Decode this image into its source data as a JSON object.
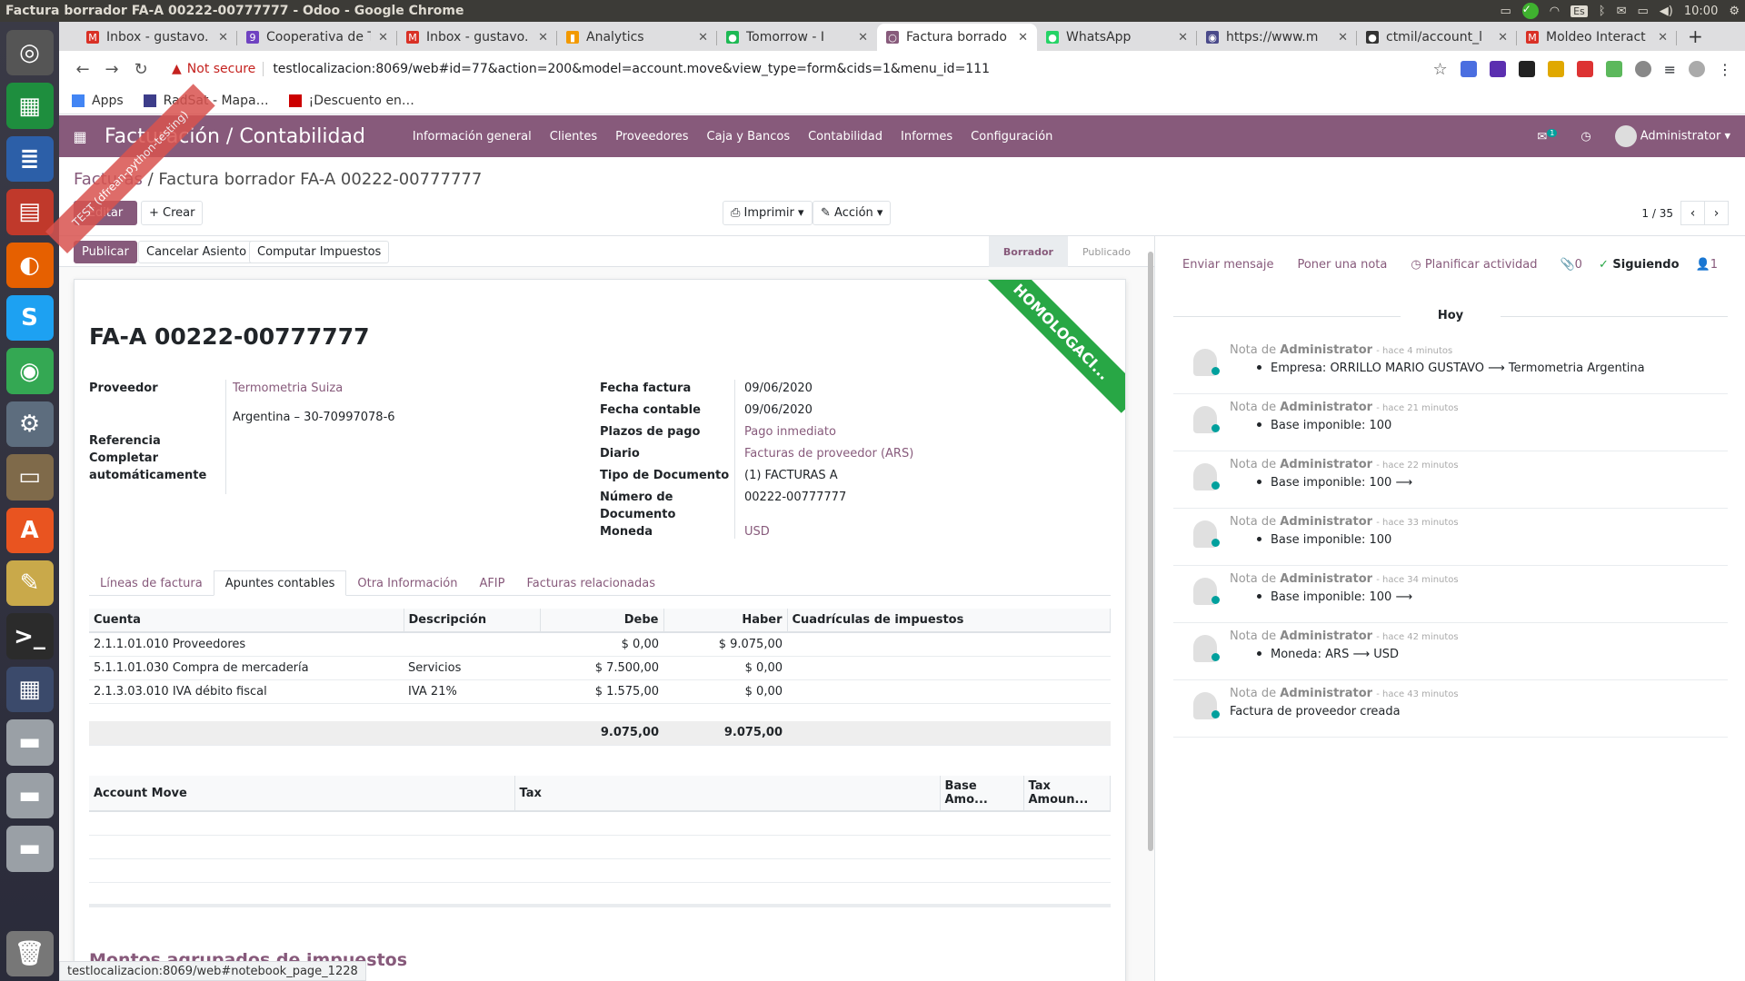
{
  "window_title": "Factura borrador FA-A 00222-00777777 - Odoo - Google Chrome",
  "system": {
    "lang": "Es",
    "time": "10:00"
  },
  "tabs": [
    {
      "label": "Inbox - gustavo.",
      "color": "#d93025",
      "fav": "M"
    },
    {
      "label": "Cooperativa de T",
      "color": "#6f42c1",
      "fav": "9"
    },
    {
      "label": "Inbox - gustavo.",
      "color": "#d93025",
      "fav": "M"
    },
    {
      "label": "Analytics",
      "color": "#f29900",
      "fav": "▮"
    },
    {
      "label": "Tomorrow - I",
      "color": "#1db954",
      "fav": "●"
    },
    {
      "label": "Factura borrado",
      "color": "#875a7b",
      "fav": "○"
    },
    {
      "label": "WhatsApp",
      "color": "#25d366",
      "fav": "●"
    },
    {
      "label": "https://www.m",
      "color": "#4a4a8a",
      "fav": "◉"
    },
    {
      "label": "ctmil/account_l",
      "color": "#333",
      "fav": "●"
    },
    {
      "label": "Moldeo Interact",
      "color": "#d93025",
      "fav": "M"
    }
  ],
  "address": {
    "security": "Not secure",
    "url": "testlocalizacion:8069/web#id=77&action=200&model=account.move&view_type=form&cids=1&menu_id=111"
  },
  "bookmarks": [
    {
      "label": "Apps",
      "color": "#4285f4"
    },
    {
      "label": "RadSat - Mapa…",
      "color": "#3d3d8a"
    },
    {
      "label": "¡Descuento en…",
      "color": "#c00"
    }
  ],
  "odoo": {
    "brand": "Facturación / Contabilidad",
    "menu": [
      "Información general",
      "Clientes",
      "Proveedores",
      "Caja y Bancos",
      "Contabilidad",
      "Informes",
      "Configuración"
    ],
    "chat_count": "1",
    "user": "Administrator"
  },
  "ribbon": "TEST (dfrean-python-testing)",
  "control": {
    "bc_parent": "Facturas",
    "bc_current": "Factura borrador FA-A 00222-00777777",
    "edit": "Editar",
    "create": "Crear",
    "print": "Imprimir",
    "action": "Acción",
    "pager": "1 / 35"
  },
  "statusbar": {
    "publish": "Publicar",
    "cancel": "Cancelar Asiento",
    "compute": "Computar Impuestos",
    "state_draft": "Borrador",
    "state_posted": "Publicado"
  },
  "form": {
    "homo": "HOMOLOGACI...",
    "title": "FA-A 00222-00777777",
    "proveedor_label": "Proveedor",
    "proveedor_value": "Termometria Suiza",
    "proveedor_addr": "Argentina – 30-70997078-6",
    "ref_label": "Referencia",
    "auto_label1": "Completar",
    "auto_label2": "automáticamente",
    "fecha_factura_label": "Fecha factura",
    "fecha_factura": "09/06/2020",
    "fecha_contable_label": "Fecha contable",
    "fecha_contable": "09/06/2020",
    "plazos_label": "Plazos de pago",
    "plazos": "Pago inmediato",
    "diario_label": "Diario",
    "diario": "Facturas de proveedor (ARS)",
    "tipo_label": "Tipo de Documento",
    "tipo": "(1) FACTURAS A",
    "numero_label1": "Número de",
    "numero_label2": "Documento",
    "numero": "00222-00777777",
    "moneda_label": "Moneda",
    "moneda": "USD"
  },
  "notebook": [
    "Líneas de factura",
    "Apuntes contables",
    "Otra Información",
    "AFIP",
    "Facturas relacionadas"
  ],
  "lines": {
    "headers": [
      "Cuenta",
      "Descripción",
      "Debe",
      "Haber",
      "Cuadrículas de impuestos"
    ],
    "rows": [
      [
        "2.1.1.01.010 Proveedores",
        "",
        "$ 0,00",
        "$ 9.075,00",
        ""
      ],
      [
        "5.1.1.01.030 Compra de mercadería",
        "Servicios",
        "$ 7.500,00",
        "$ 0,00",
        ""
      ],
      [
        "2.1.3.03.010 IVA débito fiscal",
        "IVA 21%",
        "$ 1.575,00",
        "$ 0,00",
        ""
      ]
    ],
    "total_debe": "9.075,00",
    "total_haber": "9.075,00"
  },
  "taxlines": {
    "headers": [
      "Account Move",
      "Tax",
      "Base Amo...",
      "Tax Amoun..."
    ]
  },
  "montos": "Montos agrupados de impuestos",
  "chatter": {
    "send": "Enviar mensaje",
    "note": "Poner una nota",
    "plan": "Planificar actividad",
    "attach": "0",
    "follow": "Siguiendo",
    "followers": "1",
    "today": "Hoy",
    "messages": [
      {
        "prefix": "Nota de",
        "author": "Administrator",
        "time": "- hace 4 minutos",
        "body": "Empresa: ORRILLO MARIO GUSTAVO ⟶ Termometria Argentina",
        "bullet": true
      },
      {
        "prefix": "Nota de",
        "author": "Administrator",
        "time": "- hace 21 minutos",
        "body": "Base imponible: 100",
        "bullet": true
      },
      {
        "prefix": "Nota de",
        "author": "Administrator",
        "time": "- hace 22 minutos",
        "body": "Base imponible: 100 ⟶",
        "bullet": true
      },
      {
        "prefix": "Nota de",
        "author": "Administrator",
        "time": "- hace 33 minutos",
        "body": "Base imponible: 100",
        "bullet": true
      },
      {
        "prefix": "Nota de",
        "author": "Administrator",
        "time": "- hace 34 minutos",
        "body": "Base imponible: 100 ⟶",
        "bullet": true
      },
      {
        "prefix": "Nota de",
        "author": "Administrator",
        "time": "- hace 42 minutos",
        "body": "Moneda: ARS ⟶ USD",
        "bullet": true
      },
      {
        "prefix": "Nota de",
        "author": "Administrator",
        "time": "- hace 43 minutos",
        "body": "Factura de proveedor creada",
        "bullet": false
      }
    ]
  },
  "status_url": "testlocalizacion:8069/web#notebook_page_1228"
}
